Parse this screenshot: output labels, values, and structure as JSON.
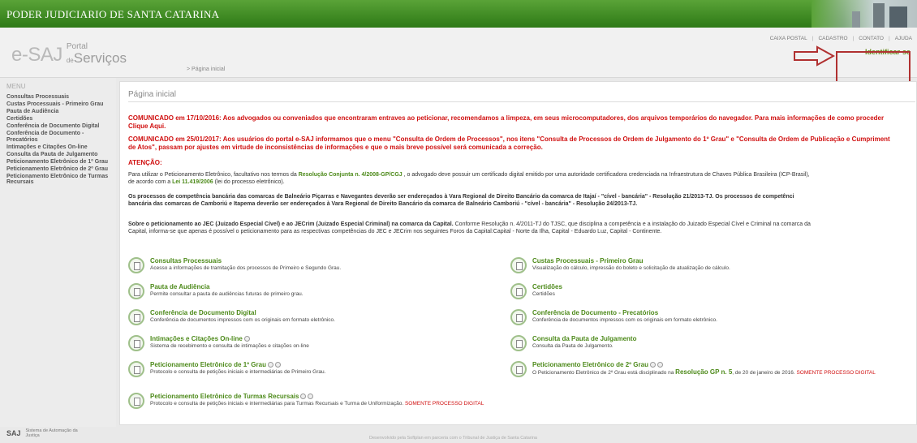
{
  "header": {
    "court_name": "PODER JUDICIARIO DE SANTA CATARINA",
    "logo_esaj": "e-SAJ",
    "logo_portal": "Portal",
    "logo_de": "de",
    "logo_servicos": "Serviços",
    "links": [
      "CAIXA POSTAL",
      "CADASTRO",
      "CONTATO",
      "AJUDA"
    ],
    "breadcrumb": "> Página inicial",
    "identify_label": "Identificar-se"
  },
  "sidebar": {
    "title": "MENU",
    "items": [
      "Consultas Processuais",
      "Custas Processuais - Primeiro Grau",
      "Pauta de Audiência",
      "Certidões",
      "Conferência de Documento Digital",
      "Conferência de Documento - Precatórios",
      "Intimações e Citações On-line",
      "Consulta da Pauta de Julgamento",
      "Peticionamento Eletrônico de 1º Grau",
      "Peticionamento Eletrônico de 2º Grau",
      "Peticionamento Eletrônico de Turmas Recursais"
    ]
  },
  "main": {
    "title": "Página inicial",
    "notice1": "COMUNICADO em 17/10/2016: Aos advogados ou conveniados que encontraram entraves ao peticionar, recomendamos a limpeza, em seus microcomputadores, dos arquivos temporários do navegador. Para mais informações de como proceder",
    "notice1_b": "Clique Aqui.",
    "notice2": "COMUNICADO em 25/01/2017: Aos usuários do portal e-SAJ informamos que o menu \"Consulta de Ordem de Processos\", nos itens \"Consulta de Processos de Ordem de Julgamento do 1º Grau\" e \"Consulta de Ordem de Publicação e Cumpriment",
    "notice2_b": "de Atos\", passam por ajustes em virtude de inconsistências de informações e que o mais breve possível será comunicada a correção.",
    "attention": "ATENÇÃO:",
    "p1_a": "Para utilizar o Peticionamento Eletrônico, facultativo nos termos da ",
    "p1_link": "Resolução Conjunta n. 4/2008-GP/CGJ",
    "p1_b": " , o advogado deve possuir um certificado digital emitido por uma autoridade certificadora credenciada na Infraestrutura de Chaves Pública Brasileira (ICP-Brasil),",
    "p1_c": "de acordo com a ",
    "p1_link2": "Lei 11.419/2006",
    "p1_d": " (lei do processo eletrônico).",
    "p2": "Os processos de competência bancária das comarcas de Balneário Piçarras e Navegantes deverão ser endereçados à Vara Regional de Direito Bancário da comarca de Itajaí - \"cível - bancária\" - Resolução 21/2013-TJ. Os processos de competênci",
    "p2_b": "bancária das comarcas de Camboriú e Itapema deverão ser endereçados à Vara Regional de Direito Bancário da comarca de Balneário Camboriú - \"cível - bancária\" - Resolução 24/2013-TJ.",
    "p3_bold": "Sobre o peticionamento ao JEC (Juizado Especial Cível) e ao JECrim (Juizado Especial Criminal) na comarca da Capital.",
    "p3_rest": " Conforme Resolução n. 4/2011-TJ do TJSC, que disciplina a competência e a instalação do Juizado Especial Cível e Criminal na comarca da",
    "p3_b": "Capital, informa-se que apenas é possível o peticionamento para as respectivas competências do JEC e JECrim nos seguintes Foros da Capital:Capital - Norte da Ilha, Capital - Eduardo Luz, Capital - Continente."
  },
  "services": [
    {
      "title": "Consultas Processuais",
      "desc": "Acesso a informações de tramitação dos processos de Primeiro e Segundo Grau."
    },
    {
      "title": "Custas Processuais - Primeiro Grau",
      "desc": "Visualização do cálculo, impressão do boleto e solicitação de atualização de cálculo."
    },
    {
      "title": "Pauta de Audiência",
      "desc": "Permite consultar a pauta de audiências futuras de primeiro grau."
    },
    {
      "title": "Certidões",
      "desc": "Certidões"
    },
    {
      "title": "Conferência de Documento Digital",
      "desc": "Conferência de documentos impressos com os originais em formato eletrônico."
    },
    {
      "title": "Conferência de Documento - Precatórios",
      "desc": "Conferência de documentos impressos com os originais em formato eletrônico."
    },
    {
      "title": "Intimações e Citações On-line",
      "desc": "Sistema de recebimento e consulta de intimações e citações on-line"
    },
    {
      "title": "Consulta da Pauta de Julgamento",
      "desc": "Consulta da Pauta de Julgamento."
    },
    {
      "title": "Peticionamento Eletrônico de 1º Grau",
      "desc": "Protocolo e consulta de petições iniciais e intermediárias de Primeiro Grau."
    },
    {
      "title": "Peticionamento Eletrônico de 2º Grau",
      "desc_a": "O Peticionamento Eletrônico de 2º Grau está disciplinado na ",
      "desc_link": "Resolução GP n. 5",
      "desc_b": ", de 20 de janeiro de 2016. ",
      "desc_red": "SOMENTE PROCESSO DIGITAL"
    },
    {
      "title": "Peticionamento Eletrônico de Turmas Recursais",
      "desc_a": "Protocolo e consulta de petições iniciais e intermediárias para Turmas Recursais e Turma de Uniformização. ",
      "desc_red": "SOMENTE PROCESSO DIGITAL"
    }
  ],
  "footer": {
    "saj": "SAJ",
    "saj_text": "Sistema de Automação da Justiça",
    "credit": "Desenvolvido pela Softplan em parceria com o Tribunal de Justiça de Santa Catarina"
  },
  "colors": {
    "accent_green": "#4d8a1a",
    "alert_red": "#d01010",
    "annotation_red": "#b03030"
  }
}
